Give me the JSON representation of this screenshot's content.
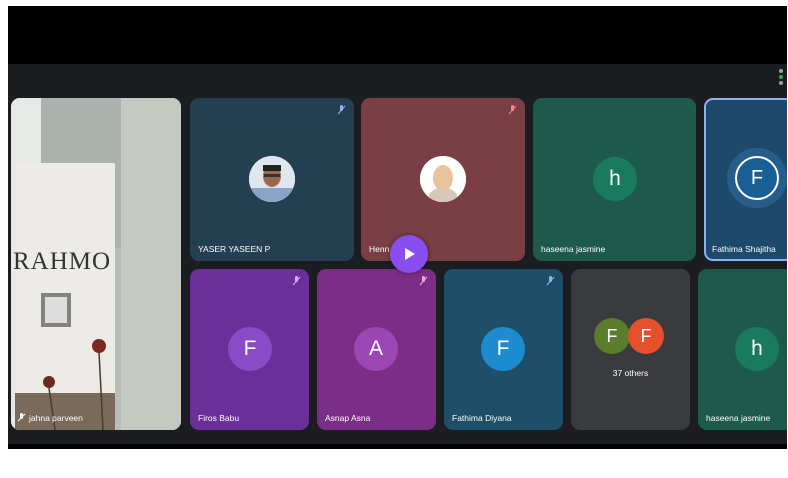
{
  "colors": {
    "tile_blue_dark": "#243f52",
    "tile_maroon": "#7a3f44",
    "tile_green": "#1d5a4b",
    "tile_purple": "#6a2f98",
    "tile_magenta": "#7a2e86",
    "tile_teal": "#1f4e68",
    "tile_grey": "#3a3b3e",
    "play_button": "#8a4df0"
  },
  "participants": [
    {
      "id": "yaser",
      "name": "YASER YASEEN P",
      "avatar_type": "photo"
    },
    {
      "id": "henna",
      "name": "Henn",
      "avatar_type": "photo"
    },
    {
      "id": "haseena1",
      "name": "haseena jasmine",
      "initial": "h",
      "avatar_color": "#1a7a5c"
    },
    {
      "id": "fathima-s",
      "name": "Fathima Shajitha",
      "initial": "F",
      "avatar_color": "#1a5f93"
    },
    {
      "id": "firos",
      "name": "Firos Babu",
      "initial": "F",
      "avatar_color": "#8a4bc7"
    },
    {
      "id": "asnap",
      "name": "Asnap Asna",
      "initial": "A",
      "avatar_color": "#9b46b2"
    },
    {
      "id": "fathima-d",
      "name": "Fathima Diyana",
      "initial": "F",
      "avatar_color": "#1d8ccf"
    },
    {
      "id": "haseena2",
      "name": "haseena jasmine",
      "initial": "h",
      "avatar_color": "#1a7a5c"
    }
  ],
  "others_tile": {
    "label": "37 others",
    "initials": [
      "F",
      "F"
    ],
    "colors": [
      "#5a7d2e",
      "#e6502a"
    ]
  },
  "self_view": {
    "name": "jahna parveen",
    "banner_text": "RAHMO"
  },
  "icons": {
    "mic": "mic-muted-icon",
    "play": "play-icon",
    "dots": "app-dots-icon"
  }
}
